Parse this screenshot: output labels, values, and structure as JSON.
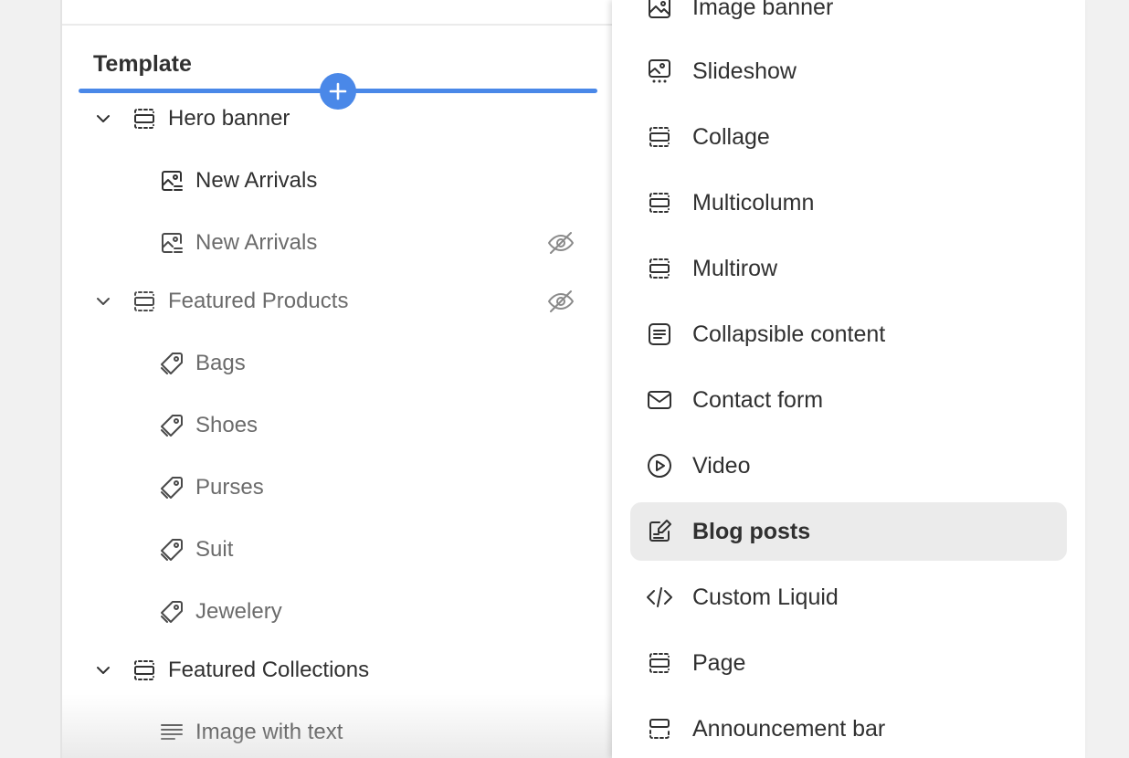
{
  "template": {
    "heading": "Template",
    "sections": [
      {
        "label": "Hero banner",
        "icon": "section-icon",
        "hidden": false,
        "blocks": [
          {
            "label": "New Arrivals",
            "icon": "image-block-icon",
            "hidden": false
          },
          {
            "label": "New Arrivals",
            "icon": "image-block-icon",
            "hidden": true
          }
        ]
      },
      {
        "label": "Featured Products",
        "icon": "section-icon",
        "hidden": true,
        "blocks": [
          {
            "label": "Bags",
            "icon": "tag-icon"
          },
          {
            "label": "Shoes",
            "icon": "tag-icon"
          },
          {
            "label": "Purses",
            "icon": "tag-icon"
          },
          {
            "label": "Suit",
            "icon": "tag-icon"
          },
          {
            "label": "Jewelery",
            "icon": "tag-icon"
          }
        ]
      },
      {
        "label": "Featured Collections",
        "icon": "section-icon",
        "hidden": false,
        "blocks": [
          {
            "label": "Image with text",
            "icon": "text-block-icon"
          }
        ]
      }
    ]
  },
  "picker": {
    "items": [
      {
        "label": "Image banner",
        "icon": "image-icon"
      },
      {
        "label": "Slideshow",
        "icon": "slideshow-icon"
      },
      {
        "label": "Collage",
        "icon": "section-icon"
      },
      {
        "label": "Multicolumn",
        "icon": "section-icon"
      },
      {
        "label": "Multirow",
        "icon": "section-icon"
      },
      {
        "label": "Collapsible content",
        "icon": "list-icon"
      },
      {
        "label": "Contact form",
        "icon": "mail-icon"
      },
      {
        "label": "Video",
        "icon": "play-icon"
      },
      {
        "label": "Blog posts",
        "icon": "edit-icon",
        "selected": true
      },
      {
        "label": "Custom Liquid",
        "icon": "code-icon"
      },
      {
        "label": "Page",
        "icon": "section-icon"
      },
      {
        "label": "Announcement bar",
        "icon": "announcement-icon"
      }
    ]
  },
  "colors": {
    "accent": "#4a88e8",
    "selected_bg": "#ebebeb",
    "text": "#303030",
    "muted_text": "#6b6b6b"
  }
}
